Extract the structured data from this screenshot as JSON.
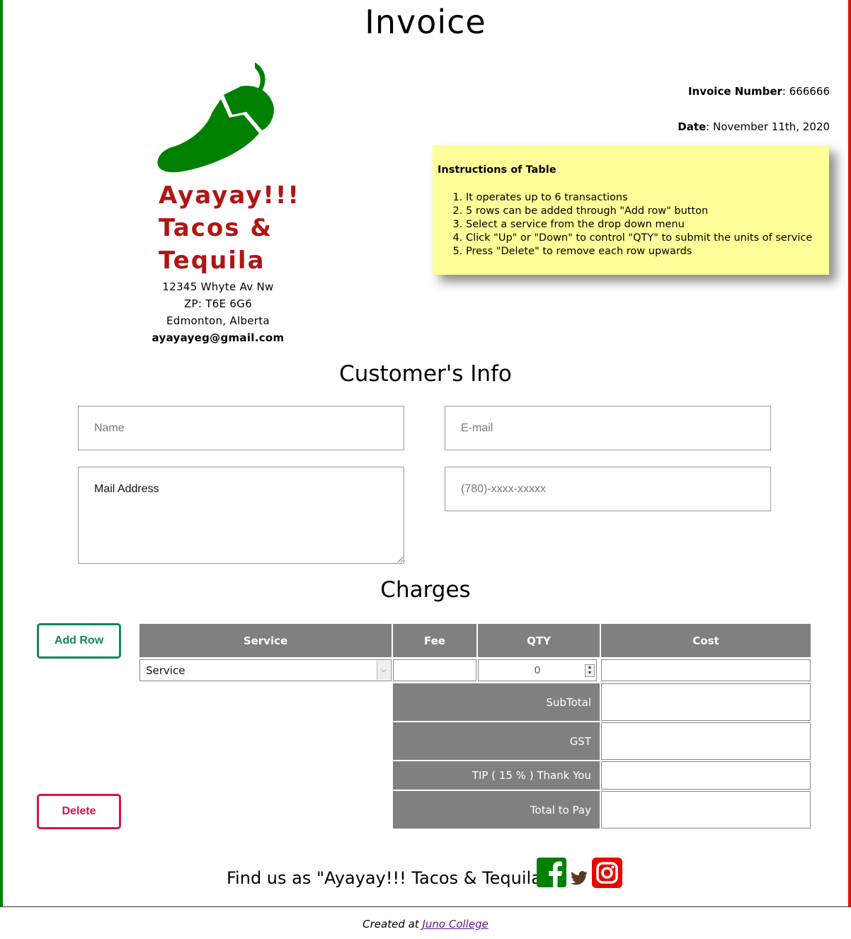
{
  "page_title": "Invoice",
  "business": {
    "name_lines": [
      "Ayayay!!!",
      "Tacos &",
      "Tequila"
    ],
    "address_line1": "12345 Whyte Av Nw",
    "address_line2": "ZP: T6E 6G6",
    "address_line3": "Edmonton, Alberta",
    "email": "ayayayeg@gmail.com",
    "logo_icon": "chili-pepper-icon"
  },
  "invoice": {
    "number_label": "Invoice Number",
    "number_value": "666666",
    "date_label": "Date",
    "date_value": "November 11th, 2020"
  },
  "instructions": {
    "title": "Instructions of Table",
    "items": [
      "It operates up to 6 transactions",
      "5 rows can be added through \"Add row\" button",
      "Select a service from the drop down menu",
      "Click \"Up\" or \"Down\" to control \"QTY\" to submit the units of service",
      "Press \"Delete\" to remove each row upwards"
    ]
  },
  "customer": {
    "section_title": "Customer's Info",
    "name_placeholder": "Name",
    "email_placeholder": "E-mail",
    "address_placeholder": "Mail Address",
    "phone_placeholder": "(780)-xxxx-xxxxx"
  },
  "charges": {
    "section_title": "Charges",
    "add_row_label": "Add Row",
    "delete_label": "Delete",
    "headers": [
      "Service",
      "Fee",
      "QTY",
      "Cost"
    ],
    "row": {
      "service": "Service",
      "qty": "0"
    },
    "subtotal_label": "SubTotal",
    "gst_label": "GST",
    "tip_label": "TIP ( 15 % ) Thank You",
    "total_label": "Total to Pay"
  },
  "footer": {
    "find_us": "Find us as \"Ayayay!!! Tacos & Tequila\":",
    "social_icons": [
      "facebook-icon",
      "twitter-icon",
      "instagram-icon"
    ],
    "credit_prefix": "Created at",
    "credit_link": "Juno College"
  },
  "colors": {
    "left_border": "#008000",
    "right_border": "#dd1111",
    "brand_red": "#b01515",
    "note_yellow": "#ffff99",
    "table_header_gray": "#808080",
    "add_green": "#118855",
    "delete_red": "#dd1144",
    "facebook_green": "#008000",
    "twitter_brown": "#5a3a22",
    "instagram_red": "#ee0000"
  }
}
